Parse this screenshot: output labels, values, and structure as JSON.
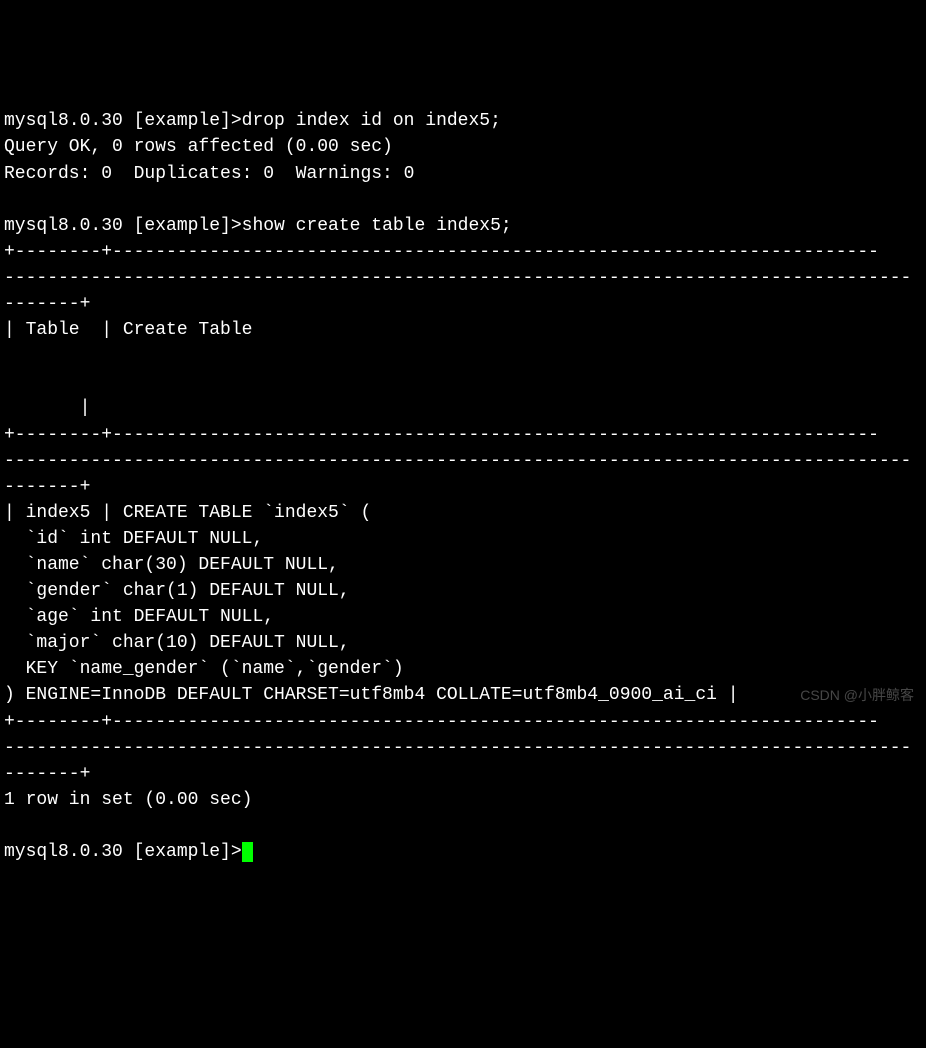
{
  "session": {
    "prompt1": "mysql8.0.30 [example]>",
    "command1": "drop index id on index5;",
    "result1_line1": "Query OK, 0 rows affected (0.00 sec)",
    "result1_line2": "Records: 0  Duplicates: 0  Warnings: 0",
    "prompt2": "mysql8.0.30 [example]>",
    "command2": "show create table index5;",
    "border_top1": "+--------+-----------------------------------------------------------------------",
    "border_dashes": "------------------------------------------------------------------------------------",
    "border_dashes_end": "-------+",
    "header_row": "| Table  | Create Table                                                           ",
    "border_mid1": "+--------+-----------------------------------------------------------------------",
    "data_row_start": "| index5 | CREATE TABLE `index5` (",
    "data_line2": "  `id` int DEFAULT NULL,",
    "data_line3": "  `name` char(30) DEFAULT NULL,",
    "data_line4": "  `gender` char(1) DEFAULT NULL,",
    "data_line5": "  `age` int DEFAULT NULL,",
    "data_line6": "  `major` char(10) DEFAULT NULL,",
    "data_line7": "  KEY `name_gender` (`name`,`gender`)",
    "data_line8": ") ENGINE=InnoDB DEFAULT CHARSET=utf8mb4 COLLATE=utf8mb4_0900_ai_ci |",
    "border_bottom1": "+--------+-----------------------------------------------------------------------",
    "result2": "1 row in set (0.00 sec)",
    "prompt3": "mysql8.0.30 [example]>"
  },
  "watermark": "CSDN @小胖鲸客"
}
